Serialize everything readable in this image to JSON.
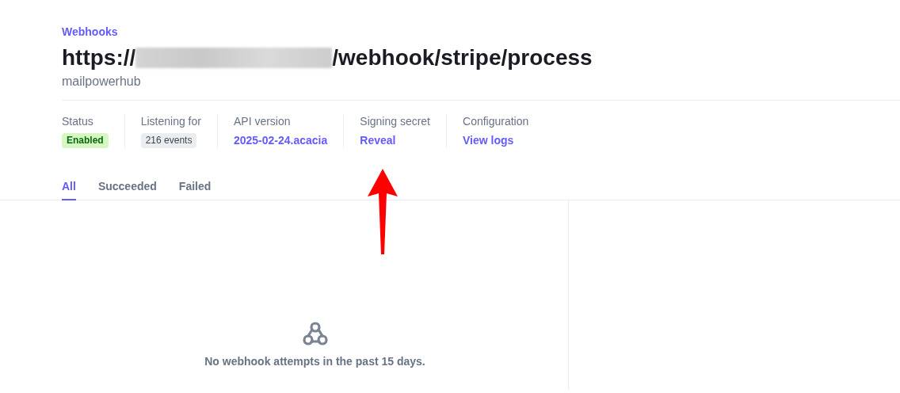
{
  "breadcrumb": "Webhooks",
  "endpoint": {
    "prefix": "https://",
    "redacted": true,
    "suffix": "/webhook/stripe/process"
  },
  "account": "mailpowerhub",
  "details": [
    {
      "label": "Status",
      "value": "Enabled",
      "kind": "success-badge"
    },
    {
      "label": "Listening for",
      "value": "216 events",
      "kind": "neutral-badge"
    },
    {
      "label": "API version",
      "value": "2025-02-24.acacia",
      "kind": "link"
    },
    {
      "label": "Signing secret",
      "value": "Reveal",
      "kind": "link"
    },
    {
      "label": "Configuration",
      "value": "View logs",
      "kind": "link"
    }
  ],
  "tabs": [
    {
      "label": "All",
      "selected": true
    },
    {
      "label": "Succeeded",
      "selected": false
    },
    {
      "label": "Failed",
      "selected": false
    }
  ],
  "empty_state": {
    "message": "No webhook attempts in the past 15 days."
  },
  "annotation": {
    "kind": "arrow"
  }
}
